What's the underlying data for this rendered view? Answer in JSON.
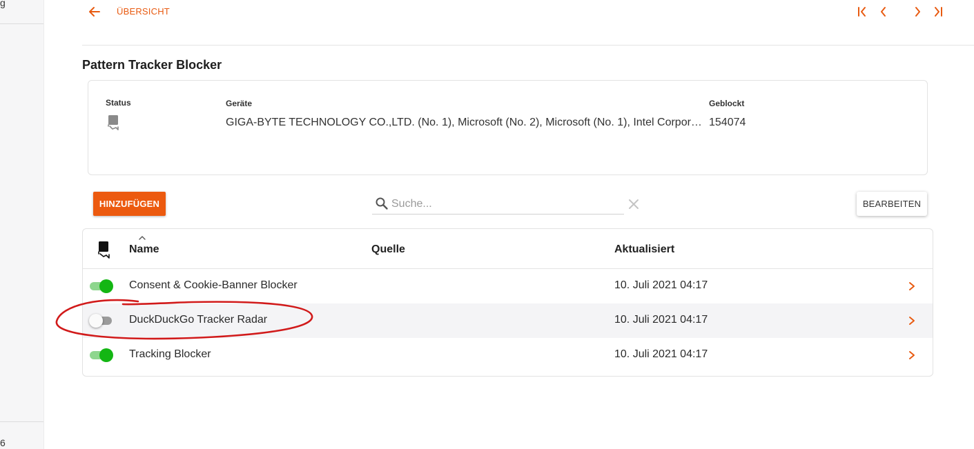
{
  "sidebar": {
    "fragment_top": "g",
    "fragment_bottom": "6"
  },
  "header": {
    "back_label": "ÜBERSICHT"
  },
  "page": {
    "title": "Pattern Tracker Blocker"
  },
  "info": {
    "status_label": "Status",
    "devices_label": "Geräte",
    "devices_value": "GIGA-BYTE TECHNOLOGY CO.,LTD. (No. 1), Microsoft (No. 2), Microsoft (No. 1), Intel Corpor…",
    "blocked_label": "Geblockt",
    "blocked_value": "154074"
  },
  "toolbar": {
    "add_label": "HINZUFÜGEN",
    "search_placeholder": "Suche...",
    "edit_label": "BEARBEITEN"
  },
  "table": {
    "headers": {
      "name": "Name",
      "source": "Quelle",
      "updated": "Aktualisiert"
    },
    "rows": [
      {
        "enabled": true,
        "name": "Consent & Cookie-Banner Blocker",
        "source": "",
        "updated": "10. Juli 2021 04:17"
      },
      {
        "enabled": false,
        "name": "DuckDuckGo Tracker Radar",
        "source": "",
        "updated": "10. Juli 2021 04:17"
      },
      {
        "enabled": true,
        "name": "Tracking Blocker",
        "source": "",
        "updated": "10. Juli 2021 04:17"
      }
    ]
  },
  "colors": {
    "accent": "#ec5a0f",
    "toggle_on": "#13b613",
    "annotation": "#d11a1a"
  },
  "icons": {
    "back": "arrow-left-icon",
    "first": "first-page-icon",
    "prev": "chevron-left-icon",
    "next": "chevron-right-icon",
    "last": "last-page-icon",
    "status": "block-status-icon",
    "search": "search-icon",
    "clear": "close-icon"
  }
}
